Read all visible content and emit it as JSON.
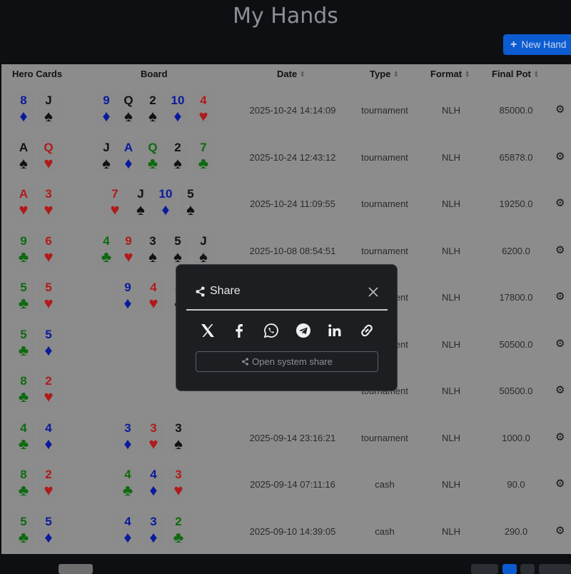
{
  "header": {
    "title": "My Hands",
    "new_hand_label": "New Hand"
  },
  "table": {
    "columns": [
      "Hero Cards",
      "Board",
      "Date",
      "Type",
      "Format",
      "Final Pot"
    ],
    "rows": [
      {
        "hero": [
          {
            "r": "8",
            "s": "♦",
            "c": "blue"
          },
          {
            "r": "J",
            "s": "♠",
            "c": "black"
          }
        ],
        "board": [
          {
            "r": "9",
            "s": "♦",
            "c": "blue"
          },
          {
            "r": "Q",
            "s": "♠",
            "c": "black"
          },
          {
            "r": "2",
            "s": "♠",
            "c": "black"
          },
          {
            "r": "10",
            "s": "♦",
            "c": "blue"
          },
          {
            "r": "4",
            "s": "♥",
            "c": "red"
          }
        ],
        "date": "2025-10-24 14:14:09",
        "type": "tournament",
        "format": "NLH",
        "pot": "85000.0"
      },
      {
        "hero": [
          {
            "r": "A",
            "s": "♠",
            "c": "black"
          },
          {
            "r": "Q",
            "s": "♥",
            "c": "red"
          }
        ],
        "board": [
          {
            "r": "J",
            "s": "♠",
            "c": "black"
          },
          {
            "r": "A",
            "s": "♦",
            "c": "blue"
          },
          {
            "r": "Q",
            "s": "♣",
            "c": "green"
          },
          {
            "r": "2",
            "s": "♠",
            "c": "black"
          },
          {
            "r": "7",
            "s": "♣",
            "c": "green"
          }
        ],
        "date": "2025-10-24 12:43:12",
        "type": "tournament",
        "format": "NLH",
        "pot": "65878.0"
      },
      {
        "hero": [
          {
            "r": "A",
            "s": "♥",
            "c": "red"
          },
          {
            "r": "3",
            "s": "♥",
            "c": "red"
          }
        ],
        "board": [
          {
            "r": "7",
            "s": "♥",
            "c": "red"
          },
          {
            "r": "J",
            "s": "♠",
            "c": "black"
          },
          {
            "r": "10",
            "s": "♦",
            "c": "blue"
          },
          {
            "r": "5",
            "s": "♠",
            "c": "black"
          }
        ],
        "date": "2025-10-24 11:09:55",
        "type": "tournament",
        "format": "NLH",
        "pot": "19250.0"
      },
      {
        "hero": [
          {
            "r": "9",
            "s": "♣",
            "c": "green"
          },
          {
            "r": "6",
            "s": "♥",
            "c": "red"
          }
        ],
        "board": [
          {
            "r": "4",
            "s": "♣",
            "c": "green"
          },
          {
            "r": "9",
            "s": "♥",
            "c": "red"
          },
          {
            "r": "3",
            "s": "♠",
            "c": "black"
          },
          {
            "r": "5",
            "s": "♠",
            "c": "black"
          },
          {
            "r": "J",
            "s": "♠",
            "c": "black"
          }
        ],
        "date": "2025-10-08 08:54:51",
        "type": "tournament",
        "format": "NLH",
        "pot": "6200.0"
      },
      {
        "hero": [
          {
            "r": "5",
            "s": "♣",
            "c": "green"
          },
          {
            "r": "5",
            "s": "♥",
            "c": "red"
          }
        ],
        "board": [
          {
            "r": "9",
            "s": "♦",
            "c": "blue"
          },
          {
            "r": "4",
            "s": "♥",
            "c": "red"
          },
          {
            "r": "J",
            "s": "♠",
            "c": "black"
          }
        ],
        "date": "",
        "type": "tournament",
        "format": "NLH",
        "pot": "17800.0"
      },
      {
        "hero": [
          {
            "r": "5",
            "s": "♣",
            "c": "green"
          },
          {
            "r": "5",
            "s": "♦",
            "c": "blue"
          }
        ],
        "board": [],
        "date": "",
        "type": "tournament",
        "format": "NLH",
        "pot": "50500.0"
      },
      {
        "hero": [
          {
            "r": "8",
            "s": "♣",
            "c": "green"
          },
          {
            "r": "2",
            "s": "♥",
            "c": "red"
          }
        ],
        "board": [],
        "date": "",
        "type": "tournament",
        "format": "NLH",
        "pot": "50500.0"
      },
      {
        "hero": [
          {
            "r": "4",
            "s": "♣",
            "c": "green"
          },
          {
            "r": "4",
            "s": "♦",
            "c": "blue"
          }
        ],
        "board": [
          {
            "r": "3",
            "s": "♦",
            "c": "blue"
          },
          {
            "r": "3",
            "s": "♥",
            "c": "red"
          },
          {
            "r": "3",
            "s": "♠",
            "c": "black"
          }
        ],
        "date": "2025-09-14 23:16:21",
        "type": "tournament",
        "format": "NLH",
        "pot": "1000.0"
      },
      {
        "hero": [
          {
            "r": "8",
            "s": "♣",
            "c": "green"
          },
          {
            "r": "2",
            "s": "♥",
            "c": "red"
          }
        ],
        "board": [
          {
            "r": "4",
            "s": "♣",
            "c": "green"
          },
          {
            "r": "4",
            "s": "♦",
            "c": "blue"
          },
          {
            "r": "3",
            "s": "♥",
            "c": "red"
          }
        ],
        "date": "2025-09-14 07:11:16",
        "type": "cash",
        "format": "NLH",
        "pot": "90.0"
      },
      {
        "hero": [
          {
            "r": "5",
            "s": "♣",
            "c": "green"
          },
          {
            "r": "5",
            "s": "♦",
            "c": "blue"
          }
        ],
        "board": [
          {
            "r": "4",
            "s": "♦",
            "c": "blue"
          },
          {
            "r": "3",
            "s": "♦",
            "c": "blue"
          },
          {
            "r": "2",
            "s": "♣",
            "c": "green"
          }
        ],
        "date": "2025-09-10 14:39:05",
        "type": "cash",
        "format": "NLH",
        "pot": "290.0"
      }
    ]
  },
  "modal": {
    "title": "Share",
    "system_share_label": "Open system share",
    "share_targets": [
      "x-icon",
      "facebook-icon",
      "whatsapp-icon",
      "telegram-icon",
      "linkedin-icon",
      "copy-link-icon"
    ]
  },
  "colors": {
    "suit_red": "#b01a1a",
    "suit_blue": "#0a1a9c",
    "suit_green": "#0e6a10",
    "suit_black": "#111111",
    "accent": "#0d5bd0"
  }
}
